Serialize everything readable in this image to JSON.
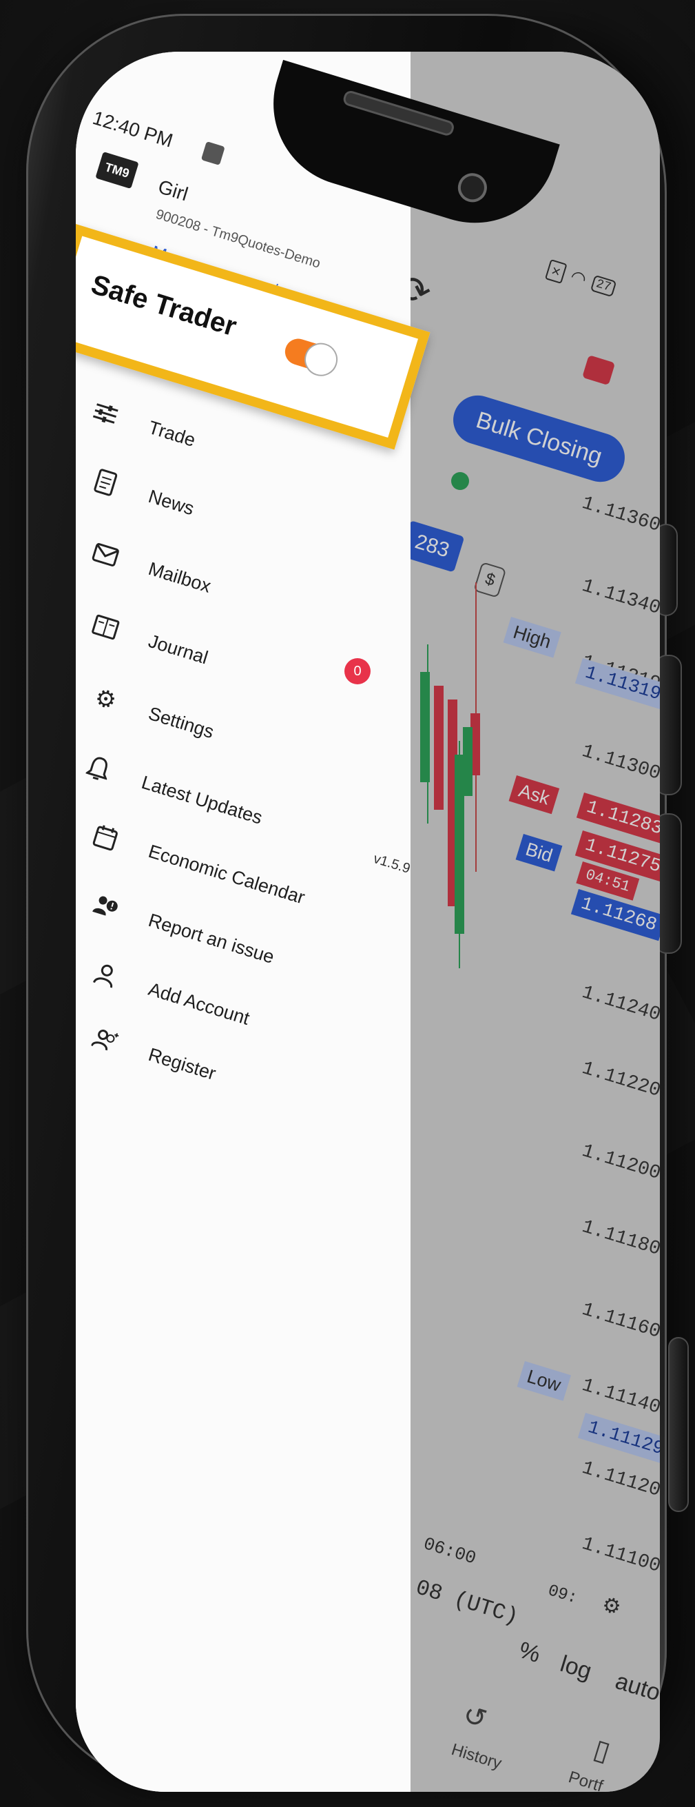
{
  "status_bar": {
    "time": "12:40 PM",
    "battery": "27"
  },
  "account": {
    "logo": "TM9",
    "name": "Girl",
    "id": "900208 - Tm9Quotes-Demo",
    "manage_link": "Manage accounts"
  },
  "safe_trader": {
    "label": "Safe Trader",
    "enabled": true
  },
  "menu": [
    {
      "label": "Trade",
      "icon": "sliders-icon"
    },
    {
      "label": "News",
      "icon": "document-icon"
    },
    {
      "label": "Mailbox",
      "icon": "mail-icon"
    },
    {
      "label": "Journal",
      "icon": "journal-icon",
      "badge": "0"
    },
    {
      "label": "Settings",
      "icon": "gear-icon"
    },
    {
      "label": "Latest Updates",
      "icon": "bell-icon"
    },
    {
      "label": "Economic Calendar",
      "icon": "calendar-icon"
    },
    {
      "label": "Report an issue",
      "icon": "report-user-icon"
    },
    {
      "label": "Add Account",
      "icon": "user-icon"
    },
    {
      "label": "Register",
      "icon": "users-add-icon"
    }
  ],
  "version": "v1.5.9",
  "app": {
    "bulk_closing": "Bulk Closing",
    "lot_value": "283",
    "price_ticks": [
      "1.11360",
      "1.11340",
      "1.11319",
      "1.11300",
      "1.11283",
      "1.11275",
      "1.11268",
      "1.11240",
      "1.11220",
      "1.11200",
      "1.11180",
      "1.11160",
      "1.11140",
      "1.11129",
      "1.11120",
      "1.11100"
    ],
    "high_label": "High",
    "high_value": "1.11319",
    "ask_label": "Ask",
    "ask_value": "1.11283",
    "mid_value": "1.11275",
    "countdown": "04:51",
    "bid_label": "Bid",
    "bid_value": "1.11268",
    "low_label": "Low",
    "low_value": "1.11129",
    "time_tick_1": "06:00",
    "time_tick_2": "09:",
    "utc_label": "08 (UTC)",
    "percent": "%",
    "log": "log",
    "auto": "auto",
    "nav_history": "History",
    "nav_portfolio": "Portf"
  },
  "colors": {
    "accent_blue": "#2f5fd6",
    "ask_red": "#d63a4a",
    "bid_blue": "#2f5fd6",
    "highlight_yellow": "#f2b619",
    "toggle_orange": "#f57c1f"
  }
}
